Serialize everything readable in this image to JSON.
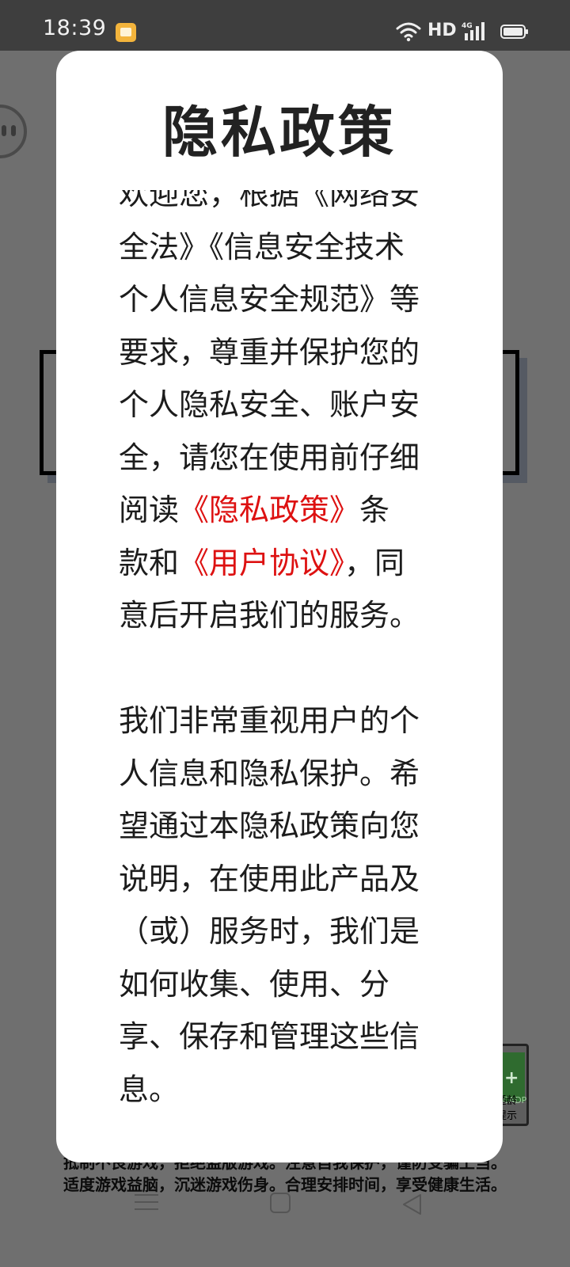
{
  "status_bar": {
    "time": "18:39",
    "network_label": "HD",
    "signal_label": "4G"
  },
  "dialog": {
    "title": "隐私政策",
    "para1": {
      "text_before": "欢迎您，根据《网络安全法》《信息安全技术个人信息安全规范》等要求，尊重并保护您的个人隐私安全、账户安全，请您在使用前仔细阅读",
      "privacy_link": "《隐私政策》",
      "text_middle": "条款和",
      "agreement_link": "《用户协议》",
      "text_after": "，同意后开启我们的服务。"
    },
    "para2": "我们非常重视用户的个人信息和隐私保护。希望通过本隐私政策向您说明，在使用此产品及（或）服务时，我们是如何收集、使用、分享、保存和管理这些信息。"
  },
  "background": {
    "notice_line1": "抵制不良游戏，拒绝盗版游戏。注意自我保护，谨防受骗上当。",
    "notice_line2": "适度游戏益脑，沉迷游戏伤身。合理安排时间，享受健康生活。",
    "age_badge_label": "适龄提示",
    "age_badge_symbol": "+",
    "age_badge_org": "CADPA"
  },
  "colors": {
    "link": "#dd1111",
    "overlay": "#6f6f6f",
    "statusbar": "#3e3e3e"
  }
}
